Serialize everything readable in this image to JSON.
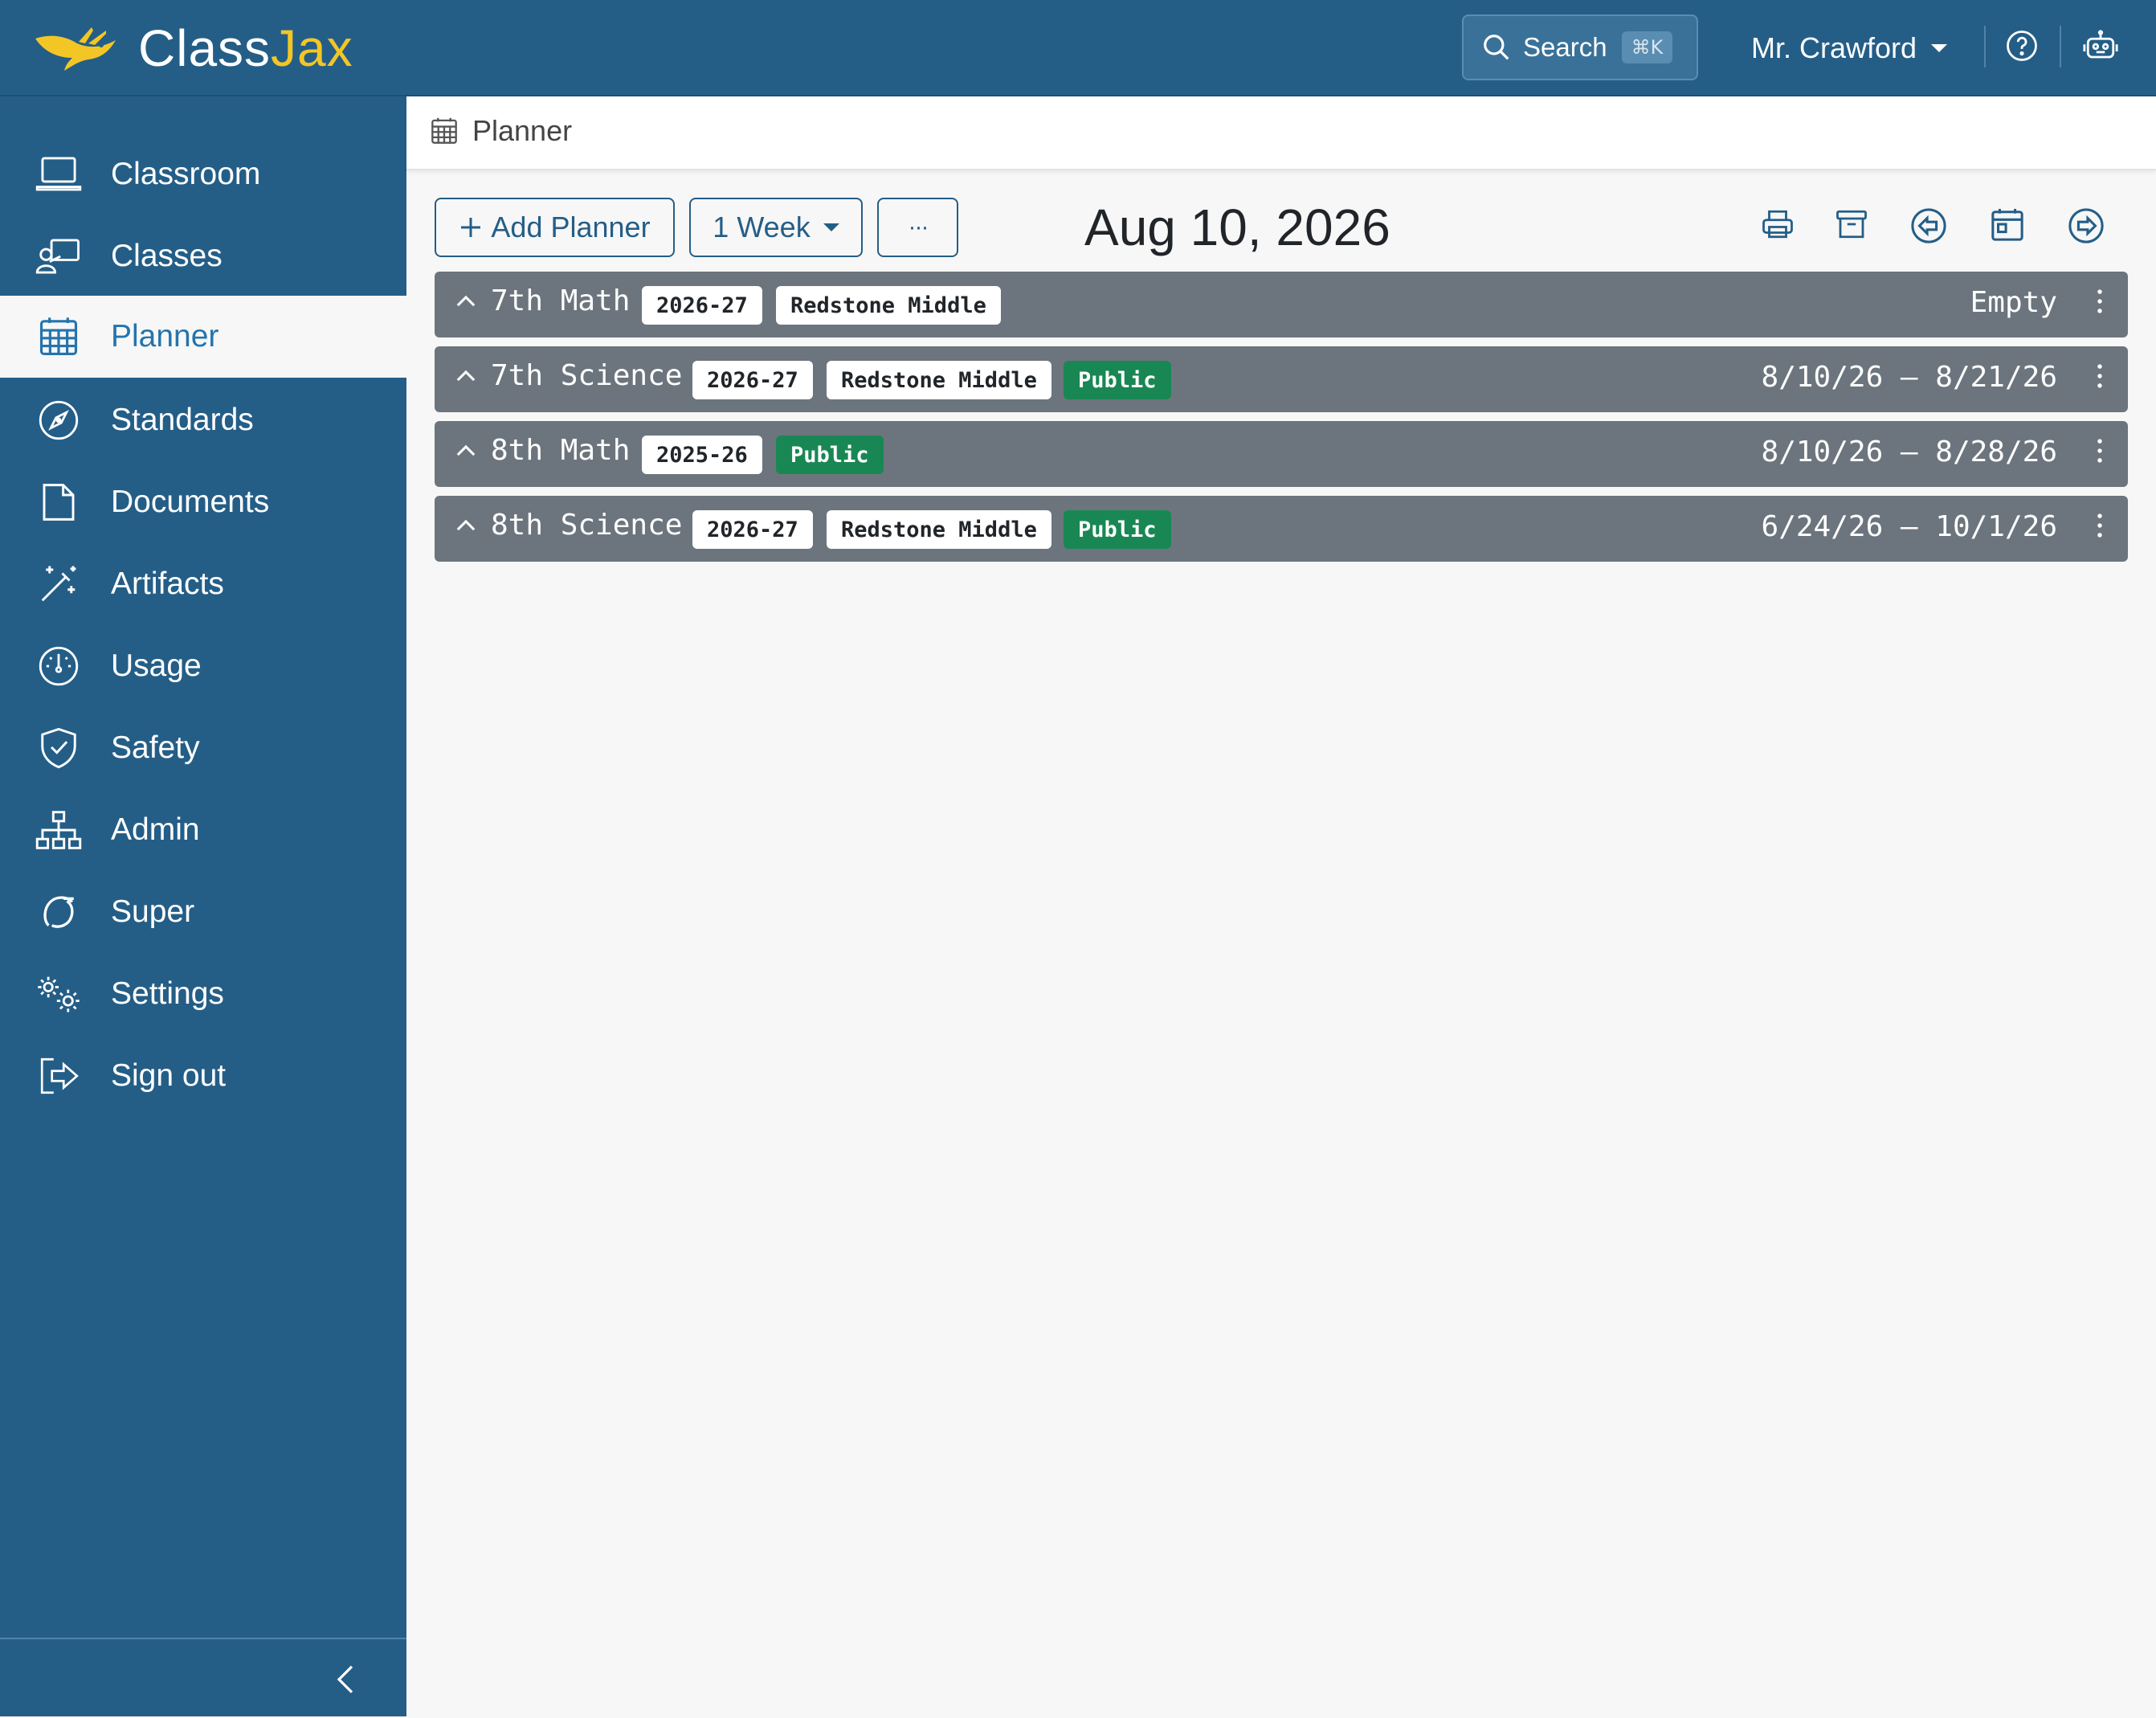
{
  "app": {
    "name_part1": "Class",
    "name_part2": "Jax",
    "brand_color": "#245e87",
    "accent_color": "#f3c626"
  },
  "topbar": {
    "search_label": "Search",
    "search_shortcut": "⌘K",
    "user_name": "Mr. Crawford",
    "icons": [
      "search-icon",
      "help-icon",
      "robot-icon"
    ]
  },
  "sidebar": {
    "items": [
      {
        "label": "Classroom",
        "icon": "laptop-icon"
      },
      {
        "label": "Classes",
        "icon": "person-board-icon"
      },
      {
        "label": "Planner",
        "icon": "calendar-grid-icon",
        "active": true
      },
      {
        "label": "Standards",
        "icon": "compass-icon"
      },
      {
        "label": "Documents",
        "icon": "file-icon"
      },
      {
        "label": "Artifacts",
        "icon": "magic-wand-icon"
      },
      {
        "label": "Usage",
        "icon": "speedometer-icon"
      },
      {
        "label": "Safety",
        "icon": "shield-check-icon"
      },
      {
        "label": "Admin",
        "icon": "diagram-icon"
      },
      {
        "label": "Super",
        "icon": "loop-icon"
      },
      {
        "label": "Settings",
        "icon": "gears-icon"
      },
      {
        "label": "Sign out",
        "icon": "sign-out-icon"
      }
    ]
  },
  "breadcrumb": {
    "title": "Planner"
  },
  "toolbar": {
    "add_planner_label": "Add Planner",
    "range_label": "1 Week",
    "more_label": "···",
    "current_date": "Aug 10, 2026",
    "icons": [
      "printer-icon",
      "archive-icon",
      "arrow-left-circle-icon",
      "calendar-today-icon",
      "arrow-right-circle-icon"
    ]
  },
  "planners": [
    {
      "title": "7th Math",
      "year": "2026-27",
      "school": "Redstone Middle",
      "visibility": "",
      "range": "Empty"
    },
    {
      "title": "7th Science",
      "year": "2026-27",
      "school": "Redstone Middle",
      "visibility": "Public",
      "range": "8/10/26 – 8/21/26"
    },
    {
      "title": "8th Math",
      "year": "2025-26",
      "school": "",
      "visibility": "Public",
      "range": "8/10/26 – 8/28/26"
    },
    {
      "title": "8th Science",
      "year": "2026-27",
      "school": "Redstone Middle",
      "visibility": "Public",
      "range": "6/24/26 – 10/1/26"
    }
  ]
}
